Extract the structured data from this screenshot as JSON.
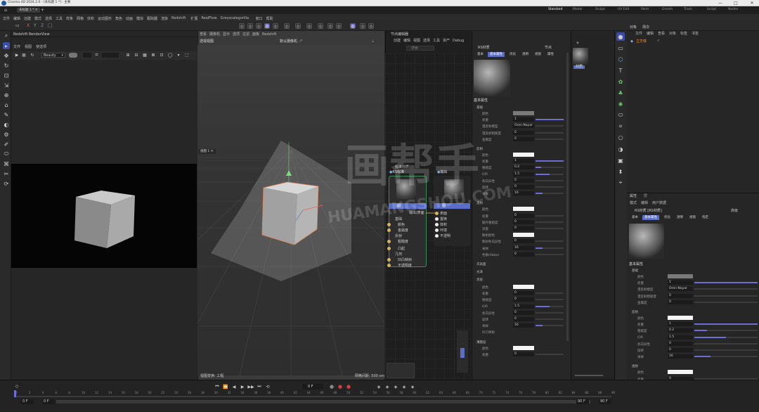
{
  "app": {
    "title": "Cinema 4D 2024.2.0 - [未标题 1 *] - 主要",
    "doc_tab": "未标题 1 *",
    "doc_tab2": "[未标题 1 *]"
  },
  "menu": [
    "文件",
    "编辑",
    "创建",
    "模式",
    "选择",
    "工具",
    "样条",
    "网格",
    "体积",
    "运动图形",
    "角色",
    "动画",
    "模拟",
    "跟踪器",
    "渲染",
    "Redshift",
    "扩展",
    "RealFlow",
    "Greyscalegorilla",
    "窗口",
    "帮助"
  ],
  "layouts": [
    "Standard",
    "Model",
    "Sculpt",
    "UV Edit",
    "Paint",
    "Groom",
    "Track",
    "Script",
    "Nodes"
  ],
  "render_view": {
    "title": "Redshift RenderView",
    "menu": [
      "文件",
      "视图",
      "使选项"
    ],
    "beauty": "Beauty",
    "zoom": "100"
  },
  "viewport": {
    "menu": [
      "查看",
      "摄像机",
      "显示",
      "选项",
      "过滤",
      "面板",
      "Redshift"
    ],
    "label": "透视视图",
    "camera": "默认摄像机 ∴°",
    "status_left": "视图变换: 工程",
    "status_right": "网格间距: 500 cm",
    "axis_x": "X",
    "axis_y": "Y",
    "axis_z": "Z",
    "watermark_cn": "画帮手",
    "watermark_en": "HUAMANGSHOU.COM",
    "tab": "视图 1"
  },
  "node_editor": {
    "title": "节点编辑器",
    "menu": [
      "创建",
      "编辑",
      "视图",
      "选择",
      "工具",
      "资产",
      "Debug",
      "模式"
    ],
    "search": "搜索",
    "node1_title": "标准材质",
    "node1_name": "RS标准",
    "node2_name": "输出",
    "node1_ports": [
      "基础",
      "颜色",
      "金属度",
      "反射",
      "粗糙度",
      "凸起",
      "几何",
      "凹凸映射",
      "不透明度"
    ],
    "node2_ports": [
      "表面",
      "置换",
      "体积",
      "环境",
      "不透明"
    ],
    "node1_out": "输出/表面",
    "node1_header": "图",
    "node2_header": "图"
  },
  "attr_top": {
    "name": "RS材质",
    "tabs": [
      "基本",
      "基本属性",
      "优化",
      "透明",
      "视窗",
      "属性"
    ],
    "mode": "节点",
    "section": "基本属性",
    "base_label": "基础",
    "base_rows": [
      {
        "label": "颜色",
        "value": ""
      },
      {
        "label": "权重",
        "value": "1"
      },
      {
        "label": "漫反射模型",
        "value": "Oren-Nayar"
      },
      {
        "label": "漫反射粗糙度",
        "value": "0"
      },
      {
        "label": "金属度",
        "value": "0"
      }
    ],
    "refl_label": "反射",
    "refl_rows": [
      {
        "label": "颜色",
        "value": ""
      },
      {
        "label": "权重",
        "value": "1"
      },
      {
        "label": "粗糙度",
        "value": "0.2"
      },
      {
        "label": "IOR",
        "value": "1.5"
      },
      {
        "label": "各向异性",
        "value": "0"
      },
      {
        "label": "旋转",
        "value": "0"
      },
      {
        "label": "采样",
        "value": "16"
      }
    ],
    "trans_label": "透射",
    "trans_rows": [
      {
        "label": "颜色",
        "value": ""
      },
      {
        "label": "权重",
        "value": "0"
      },
      {
        "label": "额外粗糙度",
        "value": "0"
      },
      {
        "label": "深度",
        "value": "0"
      },
      {
        "label": "散射颜色",
        "value": ""
      },
      {
        "label": "散射各向异性",
        "value": "0"
      },
      {
        "label": "采样",
        "value": "16"
      },
      {
        "label": "色散(Abbe)",
        "value": "0"
      }
    ],
    "sections2": [
      "次表面",
      "光泽",
      "涂层"
    ],
    "coat_rows": [
      {
        "label": "颜色",
        "value": ""
      },
      {
        "label": "权重",
        "value": "0"
      },
      {
        "label": "粗糙度",
        "value": "0"
      },
      {
        "label": "IOR",
        "value": "1.5"
      },
      {
        "label": "各向异性",
        "value": "0"
      },
      {
        "label": "旋转",
        "value": "0"
      },
      {
        "label": "采样",
        "value": "16"
      },
      {
        "label": "凹凸映射",
        "value": ""
      }
    ],
    "sheen_label": "薄膜层",
    "sheen_rows": [
      {
        "label": "颜色",
        "value": ""
      },
      {
        "label": "权重",
        "value": "0"
      }
    ]
  },
  "objects": {
    "tabs": [
      "对象",
      "场次"
    ],
    "menu": [
      "文件",
      "编辑",
      "查看",
      "对象",
      "标签",
      "书签"
    ],
    "item": "立方体"
  },
  "attr_right": {
    "title": "属性",
    "tabs2": [
      "层"
    ],
    "menu": [
      "模式",
      "编辑",
      "用户数据"
    ],
    "name": "RS材质 [RS材质]",
    "mode": "高级",
    "tabs": [
      "基本",
      "基本属性",
      "优化",
      "透明",
      "视窗",
      "指定"
    ],
    "section": "基本属性",
    "base_label": "基础",
    "base_rows": [
      {
        "label": "颜色",
        "value": ""
      },
      {
        "label": "权重",
        "value": "1"
      },
      {
        "label": "漫反射模型",
        "value": "Oren-Nayar"
      },
      {
        "label": "漫反射粗糙度",
        "value": "0"
      },
      {
        "label": "金属度",
        "value": "0"
      }
    ],
    "refl_label": "反射",
    "refl_rows": [
      {
        "label": "颜色",
        "value": ""
      },
      {
        "label": "权重",
        "value": "1"
      },
      {
        "label": "粗糙度",
        "value": "0.2"
      },
      {
        "label": "IOR",
        "value": "1.5"
      },
      {
        "label": "各向异性",
        "value": "0"
      },
      {
        "label": "旋转",
        "value": "0"
      },
      {
        "label": "采样",
        "value": "16"
      }
    ],
    "trans_label": "透射",
    "trans_rows": [
      {
        "label": "颜色",
        "value": ""
      },
      {
        "label": "权重",
        "value": "0"
      },
      {
        "label": "额外粗糙度",
        "value": "0"
      },
      {
        "label": "深度",
        "value": "0"
      }
    ]
  },
  "mat_thumb": {
    "label": "材质"
  },
  "timeline": {
    "ticks": [
      "0",
      "2",
      "4",
      "6",
      "8",
      "10",
      "12",
      "14",
      "16",
      "18",
      "20",
      "22",
      "24",
      "26",
      "28",
      "30",
      "32",
      "34",
      "36",
      "38",
      "40",
      "42",
      "44",
      "46",
      "48",
      "50",
      "52",
      "54",
      "56",
      "58",
      "60",
      "62",
      "64",
      "66",
      "68",
      "70",
      "72",
      "74",
      "76",
      "78",
      "80",
      "82",
      "84",
      "86",
      "88",
      "90"
    ],
    "start": "0 F",
    "start2": "0 F",
    "frame": "0 F",
    "end": "90 F",
    "end2": "90 F"
  },
  "colors": {
    "accent": "#6d6dd6",
    "node_blue": "#5a6ec8",
    "node_green": "#3c8a5a",
    "port_yellow": "#d8b450",
    "selection": "#e0703a"
  }
}
